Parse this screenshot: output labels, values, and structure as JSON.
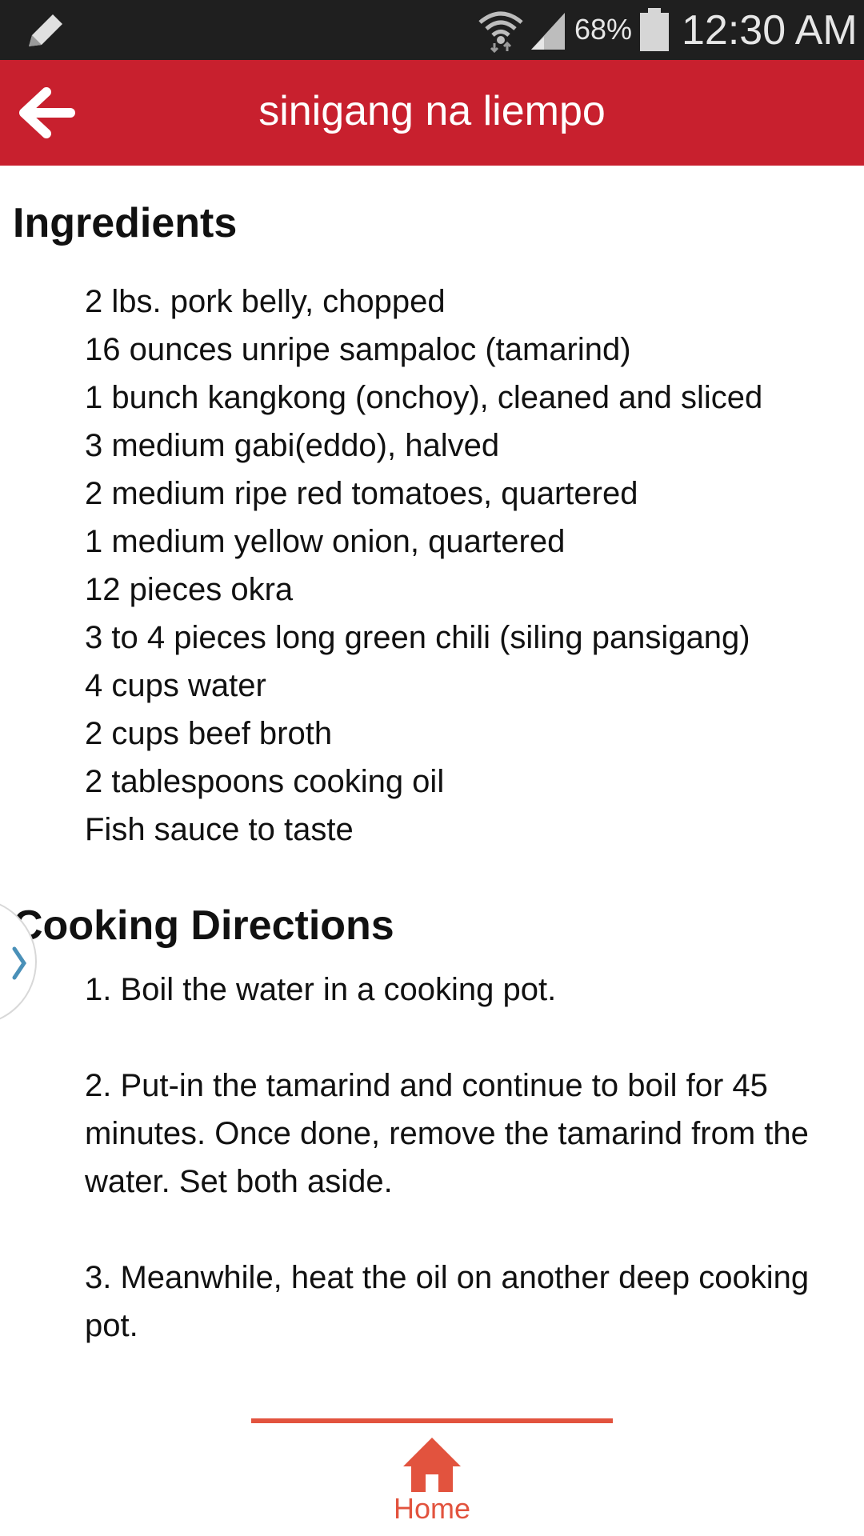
{
  "status_bar": {
    "battery_percent": "68%",
    "time": "12:30 AM"
  },
  "app_bar": {
    "title": "sinigang na liempo",
    "back_icon": "arrow-left-icon",
    "color": "#c8202e"
  },
  "ingredients": {
    "heading": "Ingredients",
    "items": [
      "2 lbs. pork belly, chopped",
      "16 ounces unripe sampaloc (tamarind)",
      "1 bunch kangkong (onchoy), cleaned and sliced",
      "3 medium gabi(eddo), halved",
      "2 medium ripe red tomatoes, quartered",
      "1 medium yellow onion, quartered",
      "12 pieces okra",
      "3 to 4 pieces long green chili (siling pansigang)",
      "4 cups water",
      "2 cups beef broth",
      "2 tablespoons cooking oil",
      "Fish sauce to taste"
    ]
  },
  "directions": {
    "heading": "Cooking Directions",
    "steps": [
      "1. Boil the water in a cooking pot.",
      "2. Put-in the tamarind and continue to boil for 45 minutes. Once done, remove the tamarind from the water. Set both aside.",
      "3. Meanwhile, heat the oil on another deep cooking pot."
    ]
  },
  "bottom_nav": {
    "home_label": "Home",
    "home_icon": "home-icon",
    "accent": "#e2533e"
  }
}
